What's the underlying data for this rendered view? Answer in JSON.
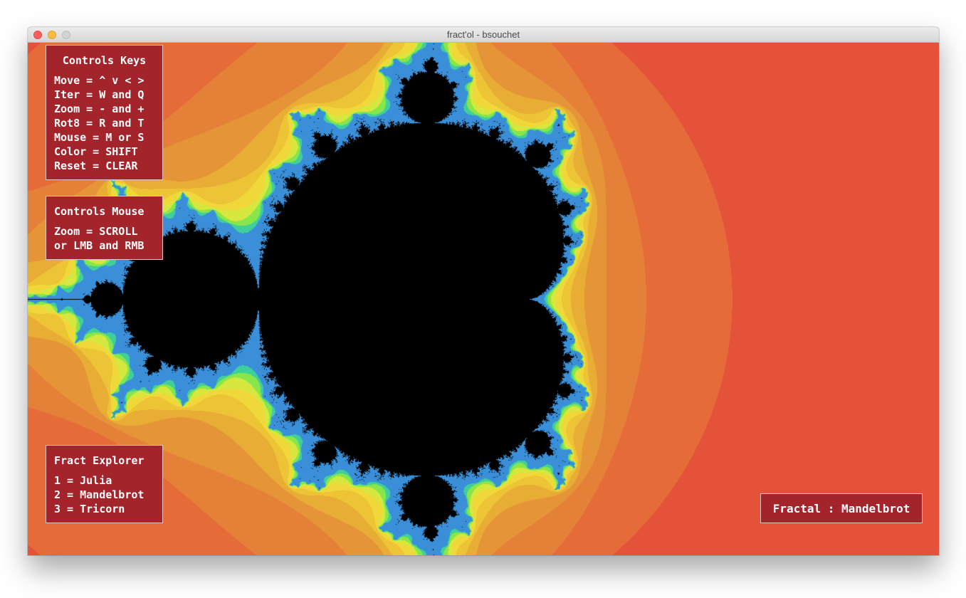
{
  "window": {
    "title": "fract'ol - bsouchet"
  },
  "colors": {
    "background": "#e83a40",
    "bands": [
      "#e5523a",
      "#e56b39",
      "#e58038",
      "#e59437",
      "#e8ad35",
      "#ecc435",
      "#f0d83a",
      "#d6e83f",
      "#88e64a",
      "#3fcf9b",
      "#3a8fd8"
    ],
    "set": "#000000",
    "panel": "#a4242c"
  },
  "controls_keys": {
    "title": "Controls Keys",
    "lines": [
      "Move = ^ v < >",
      "Iter = W and Q",
      "Zoom = - and +",
      "Rot8 = R and T",
      "Mouse = M or S",
      "Color = SHIFT",
      "Reset = CLEAR"
    ]
  },
  "controls_mouse": {
    "title": "Controls Mouse",
    "lines": [
      "Zoom = SCROLL",
      "or LMB and RMB"
    ]
  },
  "fract_explorer": {
    "title": "Fract Explorer",
    "lines": [
      "1 = Julia",
      "2 = Mandelbrot",
      "3 = Tricorn"
    ]
  },
  "status": {
    "fractal_label": "Fractal : Mandelbrot"
  }
}
